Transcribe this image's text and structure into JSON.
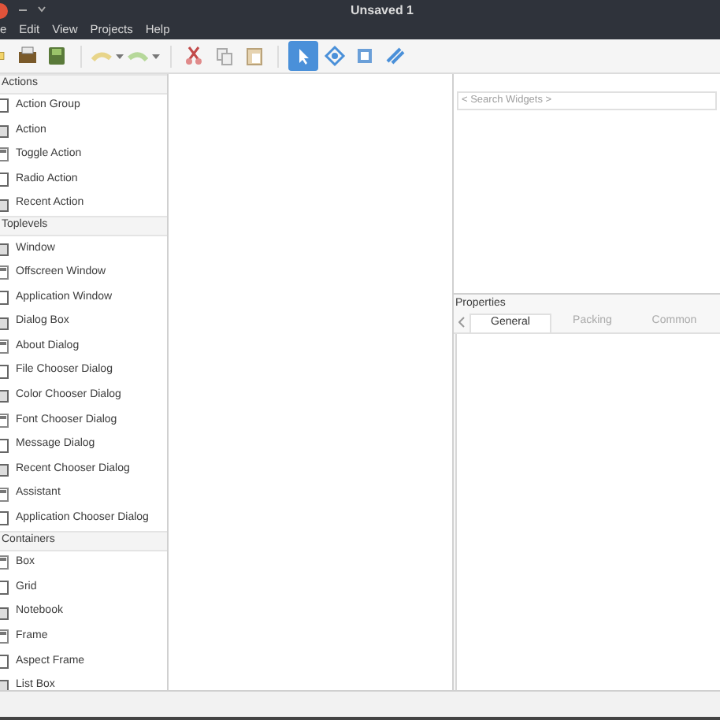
{
  "window": {
    "title": "Unsaved 1"
  },
  "menu": [
    "e",
    "Edit",
    "View",
    "Projects",
    "Help"
  ],
  "toolbar": [
    {
      "kind": "new"
    },
    {
      "kind": "open"
    },
    {
      "kind": "save"
    },
    {
      "kind": "sep"
    },
    {
      "kind": "undo"
    },
    {
      "kind": "caret"
    },
    {
      "kind": "redo"
    },
    {
      "kind": "caret"
    },
    {
      "kind": "sep"
    },
    {
      "kind": "cut"
    },
    {
      "kind": "copy"
    },
    {
      "kind": "paste"
    },
    {
      "kind": "sep"
    },
    {
      "kind": "pointer",
      "selected": true
    },
    {
      "kind": "drag",
      "selected": false
    },
    {
      "kind": "margin",
      "selected": false
    },
    {
      "kind": "align",
      "selected": false
    }
  ],
  "palette": [
    {
      "heading": "Actions",
      "items": [
        "Action Group",
        "Action",
        "Toggle Action",
        "Radio Action",
        "Recent Action"
      ]
    },
    {
      "heading": "Toplevels",
      "items": [
        "Window",
        "Offscreen Window",
        "Application Window",
        "Dialog Box",
        "About Dialog",
        "File Chooser Dialog",
        "Color Chooser Dialog",
        "Font Chooser Dialog",
        "Message Dialog",
        "Recent Chooser Dialog",
        "Assistant",
        "Application Chooser Dialog"
      ]
    },
    {
      "heading": "Containers",
      "items": [
        "Box",
        "Grid",
        "Notebook",
        "Frame",
        "Aspect Frame",
        "List Box"
      ]
    }
  ],
  "search": {
    "placeholder": "< Search Widgets >"
  },
  "properties": {
    "title": "Properties",
    "tabs": [
      {
        "label": "General",
        "selected": true
      },
      {
        "label": "Packing",
        "selected": false
      },
      {
        "label": "Common",
        "selected": false
      }
    ]
  }
}
